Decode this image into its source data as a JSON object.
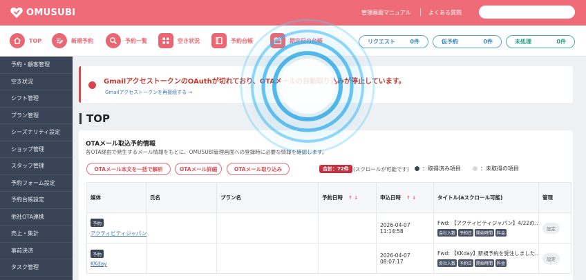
{
  "header": {
    "brand": "OMUSUBI",
    "admin_manual": "管理画面マニュアル",
    "faq": "よくある質問",
    "search_placeholder": ""
  },
  "nav": {
    "items": [
      {
        "label": "TOP",
        "icon": "home-icon"
      },
      {
        "label": "新規予約",
        "icon": "edit-icon"
      },
      {
        "label": "予約一覧",
        "icon": "search-icon"
      },
      {
        "label": "空き状況",
        "icon": "grid-icon"
      },
      {
        "label": "予約台帳",
        "icon": "book-icon"
      },
      {
        "label": "期定日の台帳",
        "icon": "calendar-icon"
      }
    ],
    "pills": [
      {
        "label": "リクエスト",
        "count": "0件",
        "style": "blue"
      },
      {
        "label": "仮予約",
        "count": "0件",
        "style": "blue"
      },
      {
        "label": "未処理",
        "count": "0件",
        "style": "green"
      }
    ]
  },
  "sidebar": {
    "items": [
      "予約・顧客管理",
      "空き状況",
      "シフト管理",
      "プラン管理",
      "シーズナリティ設定",
      "ショップ管理",
      "スタッフ管理",
      "予約フォーム設定",
      "予約台帳設定",
      "他社OTA連携",
      "売上・集計",
      "事前決済",
      "タスク管理"
    ]
  },
  "alert": {
    "title": "GmailアクセストークンのOAuthが切れており、OTAメールの自動取り込みが停止しています。",
    "link": "Gmailアクセストークンを再接続する →"
  },
  "page": {
    "title": "TOP"
  },
  "ota_panel": {
    "title": "OTAメール取込予約情報",
    "description": "各OTA経由で発生するメール情報をもとに、OMUSUBI管理画面への登録時に必要な情報を確認します。",
    "buttons": [
      "OTAメール本文を一括で解析",
      "OTAメール詳細",
      "OTAメール取り込み"
    ],
    "total": "合計：72件",
    "scroll_note": "(スクロールが可能です)",
    "legend_done": "：取得済み項目",
    "legend_todo": "：未取得の項目",
    "legend_done_color": "#3b4557",
    "legend_todo_color": "#d6d9de",
    "columns": [
      "媒体",
      "氏名",
      "プラン名",
      "予約日時",
      "申込日時",
      "タイトル(aスクロール可能)",
      "管理"
    ],
    "rows": [
      {
        "kind": "予約",
        "media": "アクティビティジャパン",
        "name": "",
        "plan": "",
        "reserve_date": "",
        "applied": "2026-04-07 11:14:58",
        "subject": "Fwd: 【アクティビティジャパン】4/22の…",
        "tags": [
          "会社入数",
          "予約日",
          "開始時間",
          "料金"
        ],
        "manage": "設定"
      },
      {
        "kind": "予約",
        "media": "KKday",
        "name": "",
        "plan": "",
        "reserve_date": "",
        "applied": "2026-04-07 08:07:17",
        "subject": "Fwd: 【KKday】新規予約を受注しました…",
        "tags": [
          "会社入数",
          "予約日",
          "開始時間",
          "料金"
        ],
        "manage": "設定"
      }
    ]
  },
  "colors": {
    "brand": "#ef6b78",
    "sidebar": "#3a4457",
    "alert": "#d9454f",
    "link": "#3a72c4"
  }
}
